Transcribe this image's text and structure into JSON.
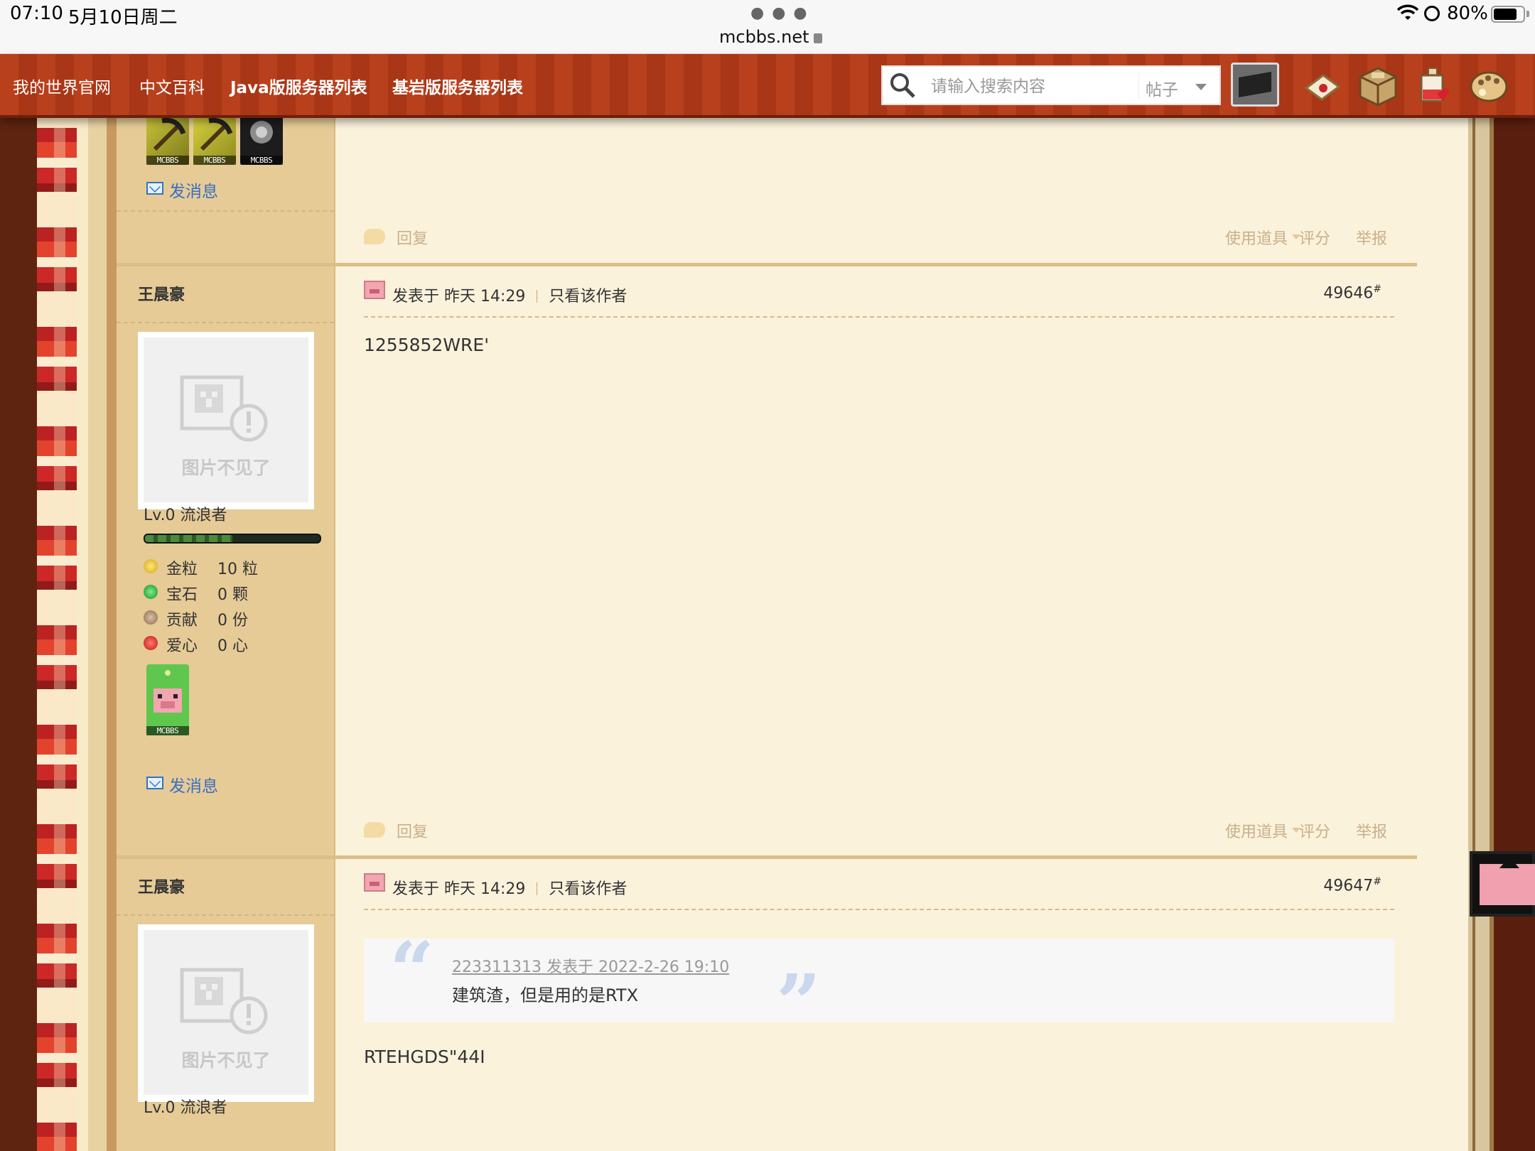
{
  "status_bar": {
    "time": "07:10",
    "date": "5月10日周二",
    "url": "mcbbs.net",
    "battery": "80%",
    "battery_level": 0.8
  },
  "nav": {
    "links": [
      "我的世界官网",
      "中文百科",
      "Java版服务器列表",
      "基岩版服务器列表"
    ],
    "search_placeholder": "请输入搜索内容",
    "search_scope": "帖子",
    "icons": [
      "obsidian-search-icon",
      "map-icon",
      "crafting-table-icon",
      "potion-icon",
      "palette-icon"
    ]
  },
  "colors": {
    "nav_bg": "#b03c1a",
    "sidebar_bg": "#e6cb97",
    "content_bg": "#fbf2dc",
    "link": "#3a6ec0"
  },
  "prev_post": {
    "badges": [
      "MCBBS",
      "MCBBS",
      "MCBBS"
    ],
    "message_label": "发消息",
    "reply_label": "回复",
    "use_tool_label": "使用道具",
    "rate_label": "评分",
    "report_label": "举报"
  },
  "posts": [
    {
      "author": "王晨豪",
      "avatar_caption": "图片不见了",
      "level": "Lv.0 流浪者",
      "level_progress": 0.5,
      "stats": [
        {
          "label": "金粒",
          "value": "10 粒"
        },
        {
          "label": "宝石",
          "value": "0 颗"
        },
        {
          "label": "贡献",
          "value": "0 份"
        },
        {
          "label": "爱心",
          "value": "0 心"
        }
      ],
      "badge": "MCBBS",
      "message_label": "发消息",
      "posted": "发表于 昨天 14:29",
      "only_author": "只看该作者",
      "floor": "49646",
      "floor_mark": "#",
      "body": "1255852WRE'",
      "reply_label": "回复",
      "use_tool_label": "使用道具",
      "rate_label": "评分",
      "report_label": "举报"
    },
    {
      "author": "王晨豪",
      "avatar_caption": "图片不见了",
      "level": "Lv.0 流浪者",
      "posted": "发表于 昨天 14:29",
      "only_author": "只看该作者",
      "floor": "49647",
      "floor_mark": "#",
      "quote_source": "223311313 发表于 2022-2-26 19:10",
      "quote_text": "建筑渣，但是用的是RTX",
      "body": "RTEHGDS\"44I"
    }
  ]
}
